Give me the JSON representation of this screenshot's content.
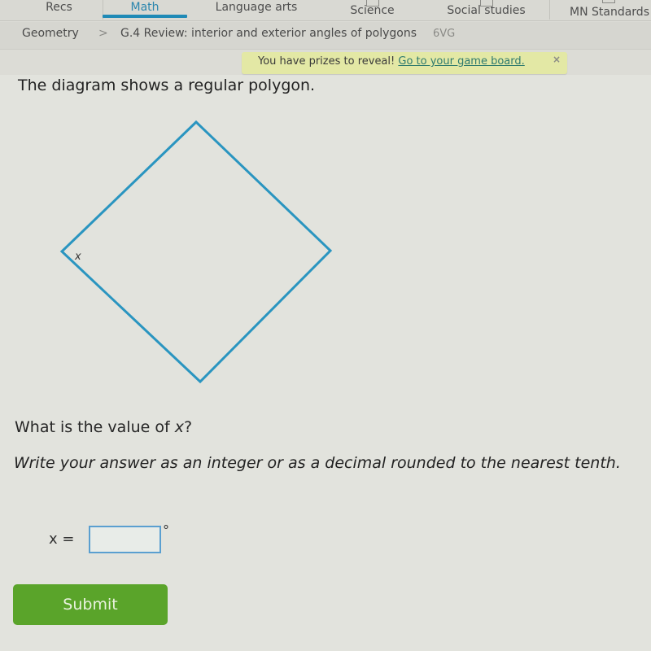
{
  "nav": {
    "tabs": [
      {
        "label": "Recs",
        "active": false
      },
      {
        "label": "Math",
        "active": true
      },
      {
        "label": "Language arts",
        "active": false
      },
      {
        "label": "Science",
        "active": false
      },
      {
        "label": "Social studies",
        "active": false
      },
      {
        "label": "MN Standards",
        "active": false
      }
    ]
  },
  "breadcrumb": {
    "subject": "Geometry",
    "separator": ">",
    "skill": "G.4 Review: interior and exterior angles of polygons",
    "skill_code": "6VG"
  },
  "banner": {
    "text": "You have prizes to reveal!",
    "link": "Go to your game board.",
    "close": "×"
  },
  "problem": {
    "prompt": "The diagram shows a regular polygon.",
    "diagram": {
      "shape": "square",
      "sides": 4,
      "orientation": "rotated 45°",
      "angle_label": "x",
      "stroke_color": "#2a95c0"
    },
    "question_prefix": "What is the value of ",
    "question_var": "x",
    "question_suffix": "?",
    "instructions": "Write your answer as an integer or as a decimal rounded to the nearest tenth.",
    "answer_label": "x =",
    "answer_value": "",
    "answer_unit": "°",
    "submit_label": "Submit"
  },
  "colors": {
    "accent": "#1f8ab6",
    "submit": "#5aa42a",
    "banner_bg": "#e3e8a5"
  }
}
